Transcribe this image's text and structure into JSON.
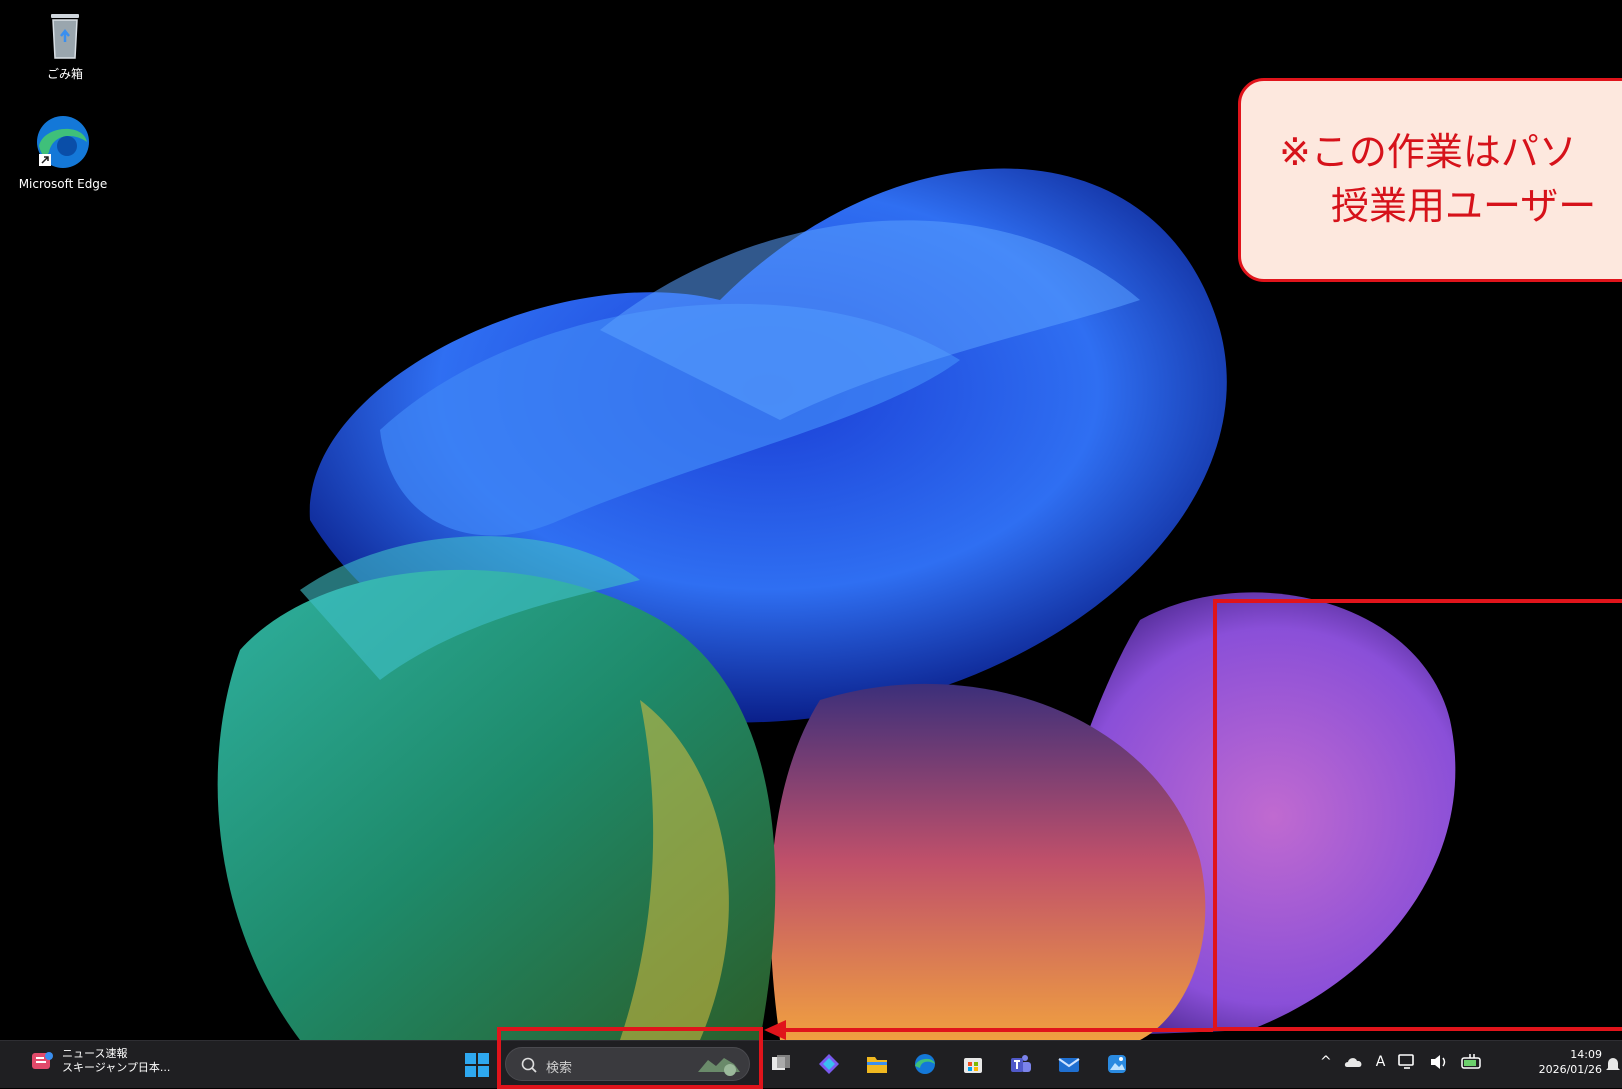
{
  "desktop": {
    "icons": [
      {
        "label": "ごみ箱",
        "icon": "recycle-bin-icon"
      },
      {
        "label": "Microsoft Edge",
        "icon": "edge-icon"
      }
    ]
  },
  "callout": {
    "line1": "※この作業はパソ",
    "line2": "授業用ユーザー"
  },
  "taskbar": {
    "widget": {
      "title": "ニュース速報",
      "subtitle": "スキージャンプ日本..."
    },
    "search_placeholder": "検索",
    "pinned": [
      "task-view-icon",
      "copilot-icon",
      "file-explorer-icon",
      "edge-icon",
      "store-icon",
      "teams-icon",
      "mail-icon",
      "photos-icon"
    ],
    "tray": {
      "ime": "A"
    },
    "clock": {
      "time": "14:09",
      "date": "2026/01/26"
    }
  },
  "colors": {
    "annotation_red": "#e0141b",
    "callout_bg": "#fde8de",
    "taskbar_bg": "#1f1f22"
  }
}
